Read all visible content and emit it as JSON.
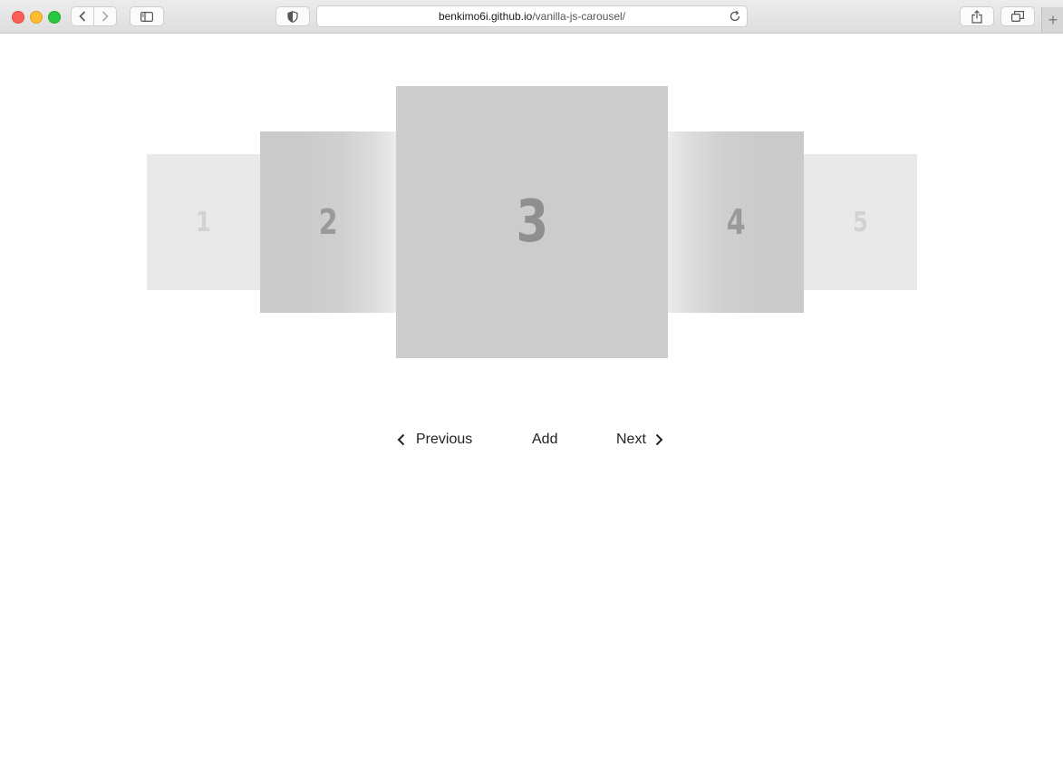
{
  "browser": {
    "url_host": "benkimo6i.github.io",
    "url_path": "/vanilla-js-carousel/",
    "new_tab_label": "+"
  },
  "carousel": {
    "slides": [
      {
        "label": "1"
      },
      {
        "label": "2"
      },
      {
        "label": "3"
      },
      {
        "label": "4"
      },
      {
        "label": "5"
      }
    ],
    "active_slide": "3"
  },
  "controls": {
    "previous_label": "Previous",
    "add_label": "Add",
    "next_label": "Next"
  }
}
